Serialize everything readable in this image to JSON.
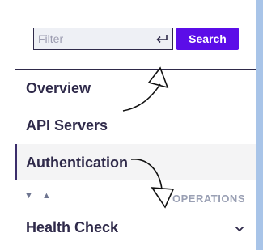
{
  "search": {
    "placeholder": "Filter",
    "button_label": "Search"
  },
  "nav": {
    "items": [
      {
        "label": "Overview",
        "active": false
      },
      {
        "label": "API Servers",
        "active": false
      },
      {
        "label": "Authentication",
        "active": true
      }
    ]
  },
  "operations": {
    "label": "OPERATIONS",
    "sort_icons": "▼ ▲"
  },
  "groups": [
    {
      "label": "Health Check",
      "expanded": false
    }
  ],
  "colors": {
    "accent": "#5b0de8",
    "text": "#2f2a4a",
    "stripe": "#a8c4e8"
  },
  "icons": {
    "enter": "enter-return-icon",
    "chevron": "chevron-down-icon"
  }
}
